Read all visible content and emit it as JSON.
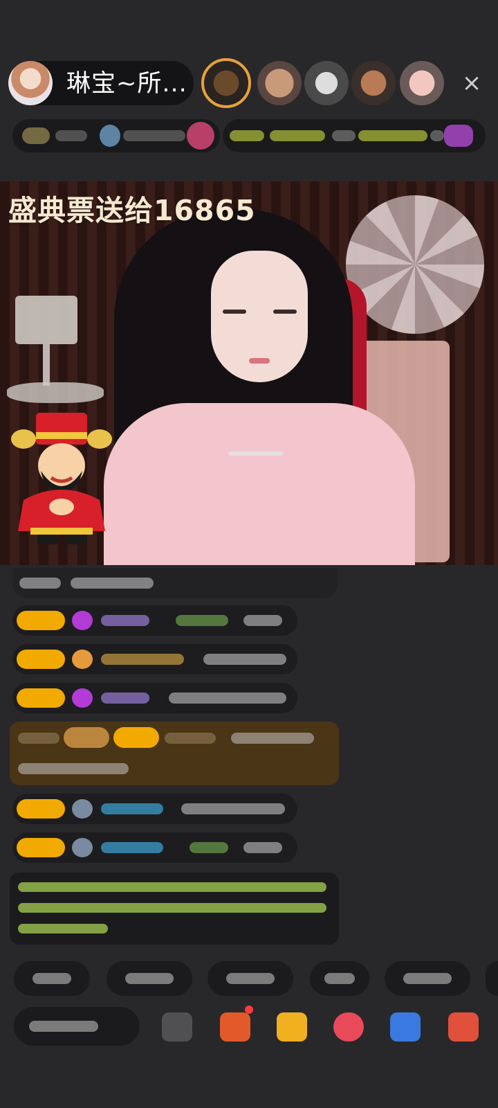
{
  "header": {
    "host_name": "琳宝~所...",
    "close_icon": "close-icon",
    "close_glyph": "×"
  },
  "video": {
    "overlay_text": "盛典票送给16865"
  },
  "colors": {
    "background": "#28282a",
    "badge_gold": "#f2a900",
    "gift_highlight": "#4a3516",
    "overlay_text": "#f6e9cf"
  },
  "icons": {
    "mascot": "god-of-wealth-sticker",
    "bottom_bar": [
      "emoji-icon",
      "red-packet-icon",
      "gift-box-icon",
      "heart-icon",
      "game-controller-icon",
      "more-apps-icon"
    ]
  }
}
